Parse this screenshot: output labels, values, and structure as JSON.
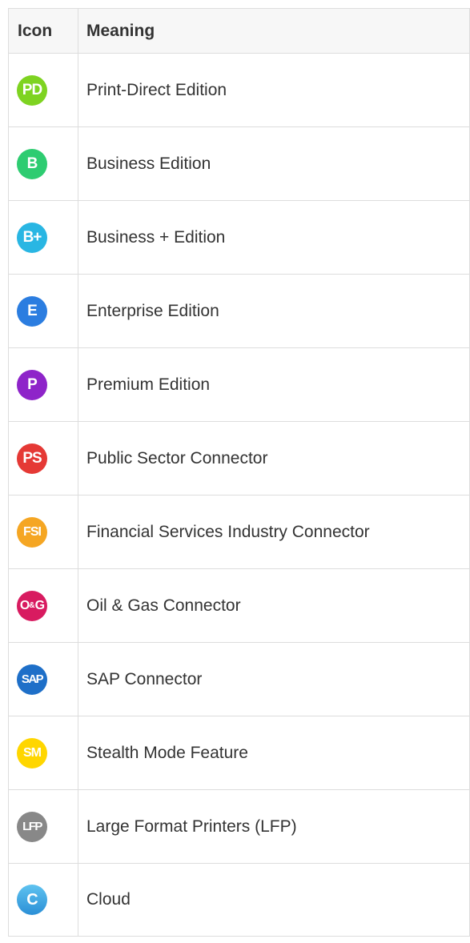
{
  "table": {
    "headers": {
      "icon": "Icon",
      "meaning": "Meaning"
    },
    "rows": [
      {
        "badge": "PD",
        "badge_color": "#7ed321",
        "label": "Print-Direct Edition"
      },
      {
        "badge": "B",
        "badge_color": "#2ecc71",
        "label": "Business Edition"
      },
      {
        "badge": "B+",
        "badge_color": "#29b6e3",
        "label": "Business + Edition"
      },
      {
        "badge": "E",
        "badge_color": "#2b7de0",
        "label": "Enterprise Edition"
      },
      {
        "badge": "P",
        "badge_color": "#8e24c9",
        "label": "Premium Edition"
      },
      {
        "badge": "PS",
        "badge_color": "#e53935",
        "label": "Public Sector Connector"
      },
      {
        "badge": "FSI",
        "badge_color": "#f5a623",
        "label": "Financial Services Industry Connector"
      },
      {
        "badge": "O",
        "badge_amp": "&",
        "badge_tail": "G",
        "badge_color": "#d81b60",
        "label": "Oil & Gas Connector"
      },
      {
        "badge": "SAP",
        "badge_color": "#1e6fc8",
        "label": "SAP Connector"
      },
      {
        "badge": "SM",
        "badge_color": "#ffd600",
        "label": "Stealth Mode Feature"
      },
      {
        "badge": "LFP",
        "badge_color": "#888888",
        "label": "Large Format Printers (LFP)"
      },
      {
        "badge": "C",
        "badge_icon": "cloud-icon",
        "badge_color": "#3aa7e6",
        "label": "Cloud"
      }
    ]
  }
}
